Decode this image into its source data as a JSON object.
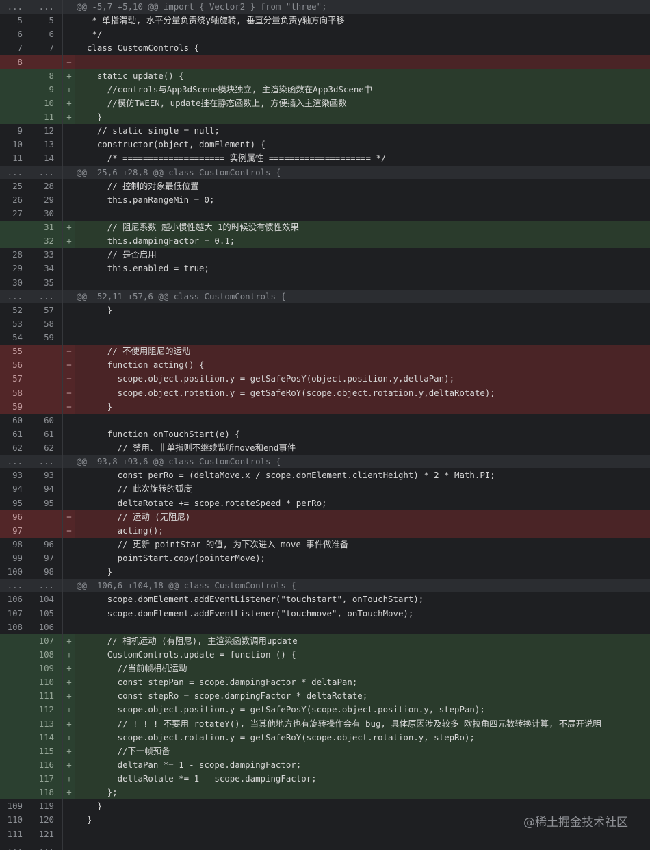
{
  "diff": {
    "rows": [
      {
        "type": "hunk",
        "old": "...",
        "new": "...",
        "mark": "",
        "text": "@@ -5,7 +5,10 @@ import { Vector2 } from \"three\";"
      },
      {
        "type": "ctx",
        "old": "5",
        "new": "5",
        "mark": "",
        "text": "   * 单指滑动, 水平分量负责绕y轴旋转, 垂直分量负责y轴方向平移"
      },
      {
        "type": "ctx",
        "old": "6",
        "new": "6",
        "mark": "",
        "text": "   */"
      },
      {
        "type": "ctx",
        "old": "7",
        "new": "7",
        "mark": "",
        "text": "  class CustomControls {"
      },
      {
        "type": "del",
        "old": "8",
        "new": "",
        "mark": "−",
        "text": ""
      },
      {
        "type": "add",
        "old": "",
        "new": "8",
        "mark": "+",
        "text": "    static update() {"
      },
      {
        "type": "add",
        "old": "",
        "new": "9",
        "mark": "+",
        "text": "      //controls与App3dScene模块独立, 主渲染函数在App3dScene中"
      },
      {
        "type": "add",
        "old": "",
        "new": "10",
        "mark": "+",
        "text": "      //模仿TWEEN, update挂在静态函数上, 方便插入主渲染函数"
      },
      {
        "type": "add",
        "old": "",
        "new": "11",
        "mark": "+",
        "text": "    }"
      },
      {
        "type": "ctx",
        "old": "9",
        "new": "12",
        "mark": "",
        "text": "    // static single = null;"
      },
      {
        "type": "ctx",
        "old": "10",
        "new": "13",
        "mark": "",
        "text": "    constructor(object, domElement) {"
      },
      {
        "type": "ctx",
        "old": "11",
        "new": "14",
        "mark": "",
        "text": "      /* ==================== 实例属性 ==================== */"
      },
      {
        "type": "hunk",
        "old": "...",
        "new": "...",
        "mark": "",
        "text": "@@ -25,6 +28,8 @@ class CustomControls {"
      },
      {
        "type": "ctx",
        "old": "25",
        "new": "28",
        "mark": "",
        "text": "      // 控制的对象最低位置"
      },
      {
        "type": "ctx",
        "old": "26",
        "new": "29",
        "mark": "",
        "text": "      this.panRangeMin = 0;"
      },
      {
        "type": "ctx",
        "old": "27",
        "new": "30",
        "mark": "",
        "text": ""
      },
      {
        "type": "add",
        "old": "",
        "new": "31",
        "mark": "+",
        "text": "      // 阻尼系数 越小惯性越大 1的时候没有惯性效果"
      },
      {
        "type": "add",
        "old": "",
        "new": "32",
        "mark": "+",
        "text": "      this.dampingFactor = 0.1;"
      },
      {
        "type": "ctx",
        "old": "28",
        "new": "33",
        "mark": "",
        "text": "      // 是否启用"
      },
      {
        "type": "ctx",
        "old": "29",
        "new": "34",
        "mark": "",
        "text": "      this.enabled = true;"
      },
      {
        "type": "ctx",
        "old": "30",
        "new": "35",
        "mark": "",
        "text": ""
      },
      {
        "type": "hunk",
        "old": "...",
        "new": "...",
        "mark": "",
        "text": "@@ -52,11 +57,6 @@ class CustomControls {"
      },
      {
        "type": "ctx",
        "old": "52",
        "new": "57",
        "mark": "",
        "text": "      }"
      },
      {
        "type": "ctx",
        "old": "53",
        "new": "58",
        "mark": "",
        "text": ""
      },
      {
        "type": "ctx",
        "old": "54",
        "new": "59",
        "mark": "",
        "text": ""
      },
      {
        "type": "del",
        "old": "55",
        "new": "",
        "mark": "−",
        "text": "      // 不使用阻尼的运动"
      },
      {
        "type": "del",
        "old": "56",
        "new": "",
        "mark": "−",
        "text": "      function acting() {"
      },
      {
        "type": "del",
        "old": "57",
        "new": "",
        "mark": "−",
        "text": "        scope.object.position.y = getSafePosY(object.position.y,deltaPan);"
      },
      {
        "type": "del",
        "old": "58",
        "new": "",
        "mark": "−",
        "text": "        scope.object.rotation.y = getSafeRoY(scope.object.rotation.y,deltaRotate);"
      },
      {
        "type": "del",
        "old": "59",
        "new": "",
        "mark": "−",
        "text": "      }"
      },
      {
        "type": "ctx",
        "old": "60",
        "new": "60",
        "mark": "",
        "text": ""
      },
      {
        "type": "ctx",
        "old": "61",
        "new": "61",
        "mark": "",
        "text": "      function onTouchStart(e) {"
      },
      {
        "type": "ctx",
        "old": "62",
        "new": "62",
        "mark": "",
        "text": "        // 禁用、非单指则不继续监听move和end事件"
      },
      {
        "type": "hunk",
        "old": "...",
        "new": "...",
        "mark": "",
        "text": "@@ -93,8 +93,6 @@ class CustomControls {"
      },
      {
        "type": "ctx",
        "old": "93",
        "new": "93",
        "mark": "",
        "text": "        const perRo = (deltaMove.x / scope.domElement.clientHeight) * 2 * Math.PI;"
      },
      {
        "type": "ctx",
        "old": "94",
        "new": "94",
        "mark": "",
        "text": "        // 此次旋转的弧度"
      },
      {
        "type": "ctx",
        "old": "95",
        "new": "95",
        "mark": "",
        "text": "        deltaRotate += scope.rotateSpeed * perRo;"
      },
      {
        "type": "del",
        "old": "96",
        "new": "",
        "mark": "−",
        "text": "        // 运动 (无阻尼)"
      },
      {
        "type": "del",
        "old": "97",
        "new": "",
        "mark": "−",
        "text": "        acting();"
      },
      {
        "type": "ctx",
        "old": "98",
        "new": "96",
        "mark": "",
        "text": "        // 更新 pointStar 的值, 为下次进入 move 事件做准备"
      },
      {
        "type": "ctx",
        "old": "99",
        "new": "97",
        "mark": "",
        "text": "        pointStart.copy(pointerMove);"
      },
      {
        "type": "ctx",
        "old": "100",
        "new": "98",
        "mark": "",
        "text": "      }"
      },
      {
        "type": "hunk",
        "old": "...",
        "new": "...",
        "mark": "",
        "text": "@@ -106,6 +104,18 @@ class CustomControls {"
      },
      {
        "type": "ctx",
        "old": "106",
        "new": "104",
        "mark": "",
        "text": "      scope.domElement.addEventListener(\"touchstart\", onTouchStart);"
      },
      {
        "type": "ctx",
        "old": "107",
        "new": "105",
        "mark": "",
        "text": "      scope.domElement.addEventListener(\"touchmove\", onTouchMove);"
      },
      {
        "type": "ctx",
        "old": "108",
        "new": "106",
        "mark": "",
        "text": ""
      },
      {
        "type": "add",
        "old": "",
        "new": "107",
        "mark": "+",
        "text": "      // 相机运动 (有阻尼), 主渲染函数调用update"
      },
      {
        "type": "add",
        "old": "",
        "new": "108",
        "mark": "+",
        "text": "      CustomControls.update = function () {"
      },
      {
        "type": "add",
        "old": "",
        "new": "109",
        "mark": "+",
        "text": "        //当前帧相机运动"
      },
      {
        "type": "add",
        "old": "",
        "new": "110",
        "mark": "+",
        "text": "        const stepPan = scope.dampingFactor * deltaPan;"
      },
      {
        "type": "add",
        "old": "",
        "new": "111",
        "mark": "+",
        "text": "        const stepRo = scope.dampingFactor * deltaRotate;"
      },
      {
        "type": "add",
        "old": "",
        "new": "112",
        "mark": "+",
        "text": "        scope.object.position.y = getSafePosY(scope.object.position.y, stepPan);"
      },
      {
        "type": "add",
        "old": "",
        "new": "113",
        "mark": "+",
        "text": "        // ! ! ! 不要用 rotateY(), 当其他地方也有旋转操作会有 bug, 具体原因涉及较多 欧拉角四元数转换计算, 不展开说明"
      },
      {
        "type": "add",
        "old": "",
        "new": "114",
        "mark": "+",
        "text": "        scope.object.rotation.y = getSafeRoY(scope.object.rotation.y, stepRo);"
      },
      {
        "type": "add",
        "old": "",
        "new": "115",
        "mark": "+",
        "text": "        //下一帧预备"
      },
      {
        "type": "add",
        "old": "",
        "new": "116",
        "mark": "+",
        "text": "        deltaPan *= 1 - scope.dampingFactor;"
      },
      {
        "type": "add",
        "old": "",
        "new": "117",
        "mark": "+",
        "text": "        deltaRotate *= 1 - scope.dampingFactor;"
      },
      {
        "type": "add",
        "old": "",
        "new": "118",
        "mark": "+",
        "text": "      };"
      },
      {
        "type": "ctx",
        "old": "109",
        "new": "119",
        "mark": "",
        "text": "    }"
      },
      {
        "type": "ctx",
        "old": "110",
        "new": "120",
        "mark": "",
        "text": "  }"
      },
      {
        "type": "ctx",
        "old": "111",
        "new": "121",
        "mark": "",
        "text": ""
      },
      {
        "type": "ctx",
        "old": "...",
        "new": "...",
        "mark": "",
        "text": ""
      }
    ]
  },
  "watermark": "@稀土掘金技术社区",
  "colors": {
    "background": "#1e1f22",
    "added": "#2a3b2c",
    "deleted": "#4a2426",
    "hunk": "#2b2d31"
  }
}
